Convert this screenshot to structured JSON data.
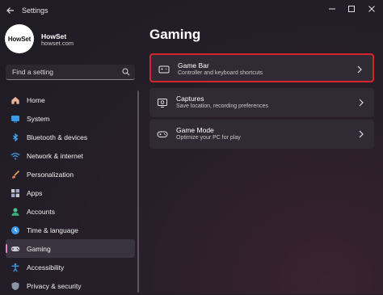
{
  "window": {
    "title": "Settings"
  },
  "profile": {
    "avatar_text": "HowSet",
    "name": "HowSet",
    "email": "howset.com"
  },
  "search": {
    "placeholder": "Find a setting"
  },
  "sidebar": {
    "items": [
      {
        "label": "Home",
        "icon": "home-icon"
      },
      {
        "label": "System",
        "icon": "system-icon"
      },
      {
        "label": "Bluetooth & devices",
        "icon": "bluetooth-icon"
      },
      {
        "label": "Network & internet",
        "icon": "network-icon"
      },
      {
        "label": "Personalization",
        "icon": "personalization-icon"
      },
      {
        "label": "Apps",
        "icon": "apps-icon"
      },
      {
        "label": "Accounts",
        "icon": "accounts-icon"
      },
      {
        "label": "Time & language",
        "icon": "time-language-icon"
      },
      {
        "label": "Gaming",
        "icon": "gaming-icon",
        "active": true
      },
      {
        "label": "Accessibility",
        "icon": "accessibility-icon"
      },
      {
        "label": "Privacy & security",
        "icon": "privacy-icon"
      }
    ]
  },
  "main": {
    "title": "Gaming",
    "cards": [
      {
        "title": "Game Bar",
        "description": "Controller and keyboard shortcuts",
        "icon": "game-bar-icon",
        "highlighted": true
      },
      {
        "title": "Captures",
        "description": "Save location, recording preferences",
        "icon": "captures-icon"
      },
      {
        "title": "Game Mode",
        "description": "Optimize your PC for play",
        "icon": "game-mode-icon"
      }
    ]
  },
  "colors": {
    "accent": "#e884c8",
    "highlight_border": "#d6262c"
  }
}
